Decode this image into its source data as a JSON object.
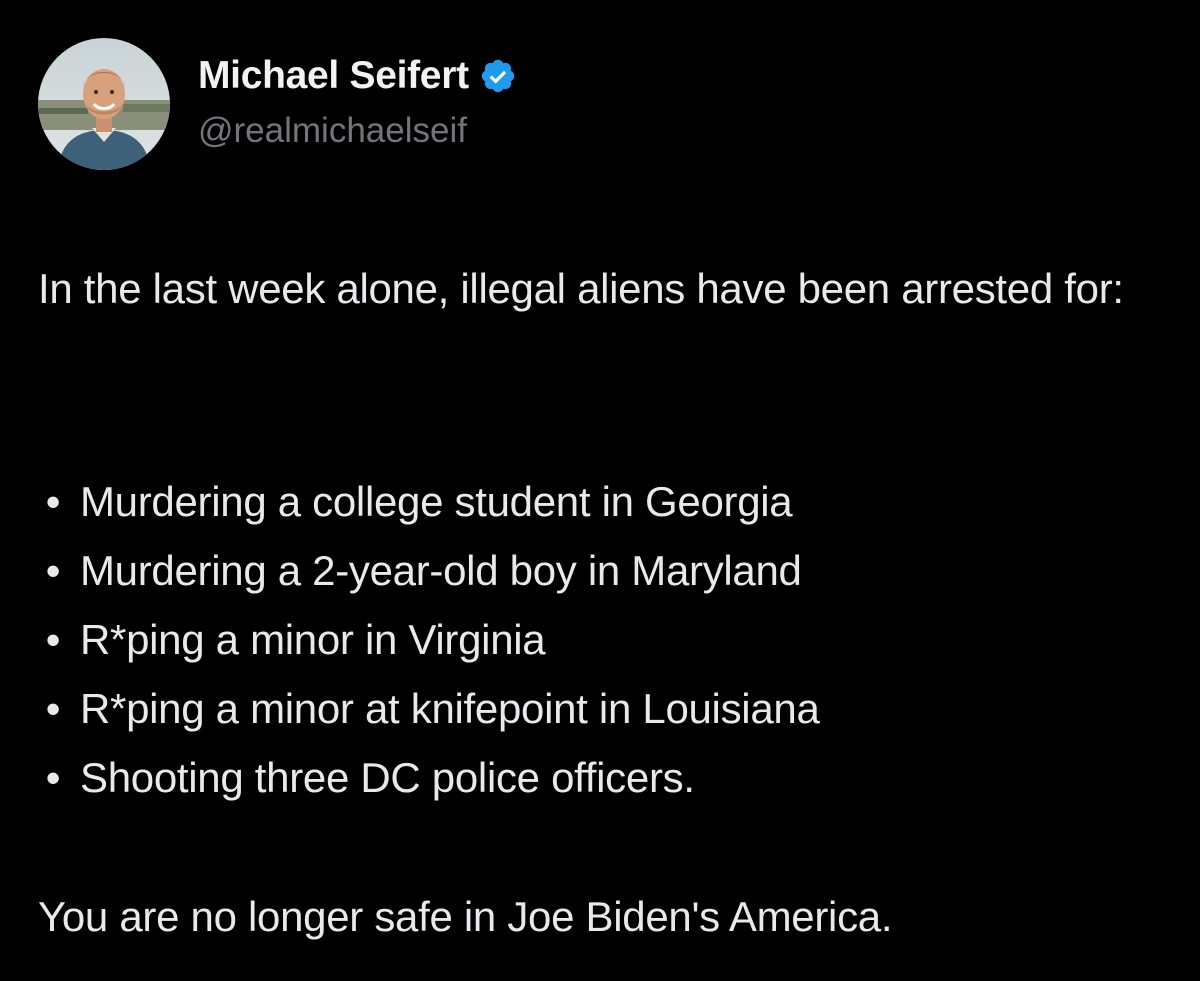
{
  "author": {
    "display_name": "Michael Seifert",
    "handle": "@realmichaelseif",
    "verified": true,
    "verified_color": "#1d9bf0",
    "avatar_icon": "profile-photo"
  },
  "post": {
    "intro": "In the last week alone, illegal aliens have been arrested for:",
    "bullet_glyph": "•",
    "items": [
      "Murdering a college student in Georgia",
      "Murdering a 2-year-old boy in Maryland",
      "R*ping a minor in Virginia",
      "R*ping a minor at knifepoint in Louisiana",
      "Shooting three DC police officers."
    ],
    "closing": "You are no longer safe in Joe Biden's America."
  },
  "colors": {
    "background": "#000000",
    "text_primary": "#e7e9ea",
    "text_secondary": "#71767b"
  }
}
